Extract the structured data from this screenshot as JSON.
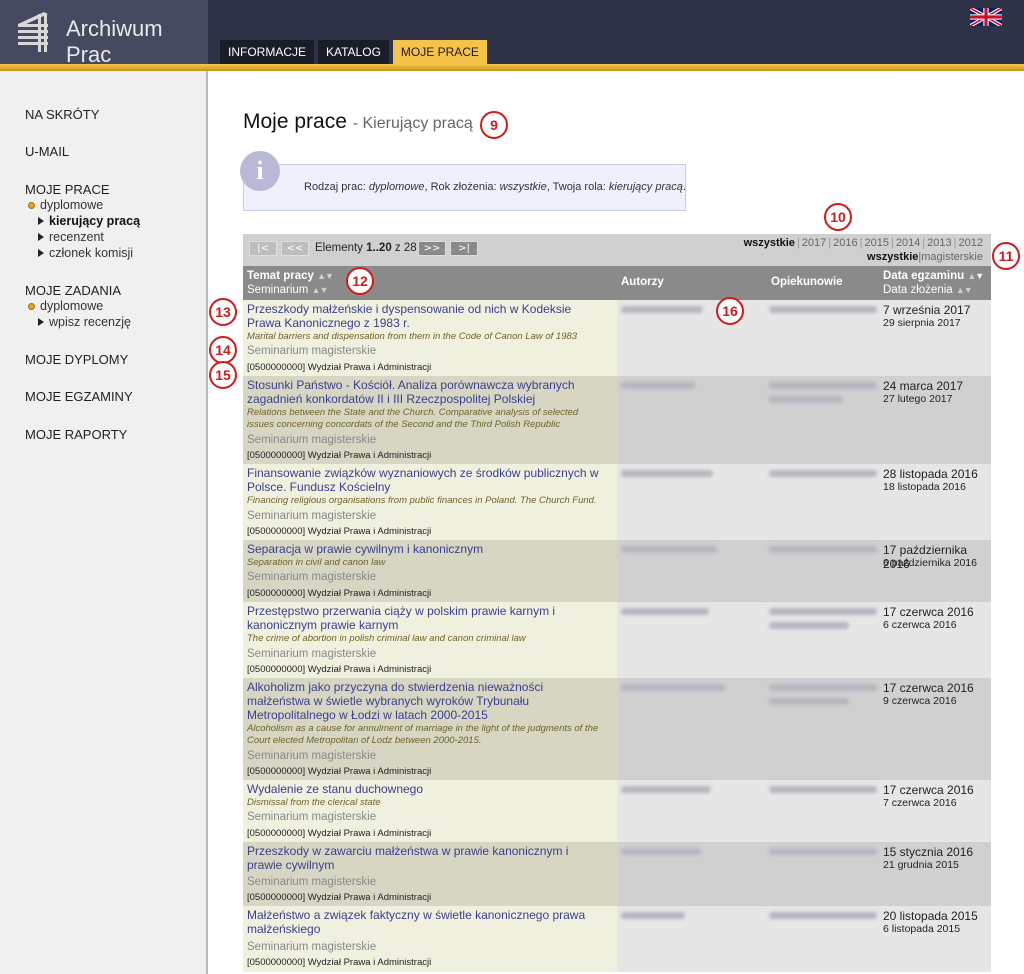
{
  "app": {
    "title": "Archiwum Prac"
  },
  "tabs": [
    {
      "label": "INFORMACJE",
      "active": false
    },
    {
      "label": "KATALOG",
      "active": false
    },
    {
      "label": "MOJE PRACE",
      "active": true
    }
  ],
  "language_flag": "uk-flag-icon",
  "sidebar": {
    "na_skroty": "NA SKRÓTY",
    "umail": "U-MAIL",
    "moje_prace": "MOJE PRACE",
    "dyplomowe": "dyplomowe",
    "kierujacy": "kierujący pracą",
    "recenzent": "recenzent",
    "czlonek": "członek komisji",
    "moje_zadania": "MOJE ZADANIA",
    "zad_dyplomowe": "dyplomowe",
    "wpisz": "wpisz recenzję",
    "moje_dyplomy": "MOJE DYPLOMY",
    "moje_egzaminy": "MOJE EGZAMINY",
    "moje_raporty": "MOJE RAPORTY"
  },
  "page": {
    "title": "Moje prace",
    "subtitle": "- Kierujący pracą"
  },
  "info": {
    "prefix1": "Rodzaj prac: ",
    "rodzaj": "dyplomowe",
    "prefix2": ", Rok złożenia: ",
    "rok": "wszystkie",
    "prefix3": ", Twoja rola: ",
    "rola": "kierujący pracą",
    "suffix": "."
  },
  "pagination": {
    "first": "|<",
    "prev": "<<",
    "next": ">>",
    "last": ">|",
    "label": "Elementy",
    "range": "1..20",
    "of": "z",
    "total": "28"
  },
  "year_filter": {
    "active": "wszystkie",
    "years": [
      "2017",
      "2016",
      "2015",
      "2014",
      "2013",
      "2012"
    ]
  },
  "type_filter": {
    "active": "wszystkie",
    "other": "magisterskie"
  },
  "columns": {
    "topic": "Temat pracy",
    "seminar": "Seminarium",
    "authors": "Autorzy",
    "supervisors": "Opiekunowie",
    "exam_date": "Data egzaminu",
    "submit_date": "Data złożenia"
  },
  "rows": [
    {
      "title": "Przeszkody małżeńskie i dyspensowanie od nich w Kodeksie Prawa Kanonicznego z 1983 r.",
      "title_en": "Marital barriers and dispensation from them in the Code of Canon Law of 1983",
      "seminar": "Seminarium magisterskie",
      "faculty": "[0500000000] Wydział Prawa i Administracji",
      "exam": "7 września 2017",
      "submitted": "29 sierpnia 2017"
    },
    {
      "title": "Stosunki Państwo - Kościół. Analiza porównawcza wybranych zagadnień konkordatów II i III Rzeczpospolitej Polskiej",
      "title_en": "Relations between the State and the Church. Comparative analysis of selected issues concerning concordats of the Second and the Third Polish Republic",
      "seminar": "Seminarium magisterskie",
      "faculty": "[0500000000] Wydział Prawa i Administracji",
      "exam": "24 marca 2017",
      "submitted": "27 lutego 2017"
    },
    {
      "title": "Finansowanie związków wyznaniowych ze środków publicznych w Polsce. Fundusz Kościelny",
      "title_en": "Financing religious organisations from public finances in Poland. The Church Fund.",
      "seminar": "Seminarium magisterskie",
      "faculty": "[0500000000] Wydział Prawa i Administracji",
      "exam": "28 listopada 2016",
      "submitted": "18 listopada 2016"
    },
    {
      "title": "Separacja w prawie cywilnym i kanonicznym",
      "title_en": "Separation in civil and canon law",
      "seminar": "Seminarium magisterskie",
      "faculty": "[0500000000] Wydział Prawa i Administracji",
      "exam": "17 października 2016",
      "submitted": "6 października 2016"
    },
    {
      "title": "Przestępstwo przerwania ciąży w polskim prawie karnym i kanonicznym prawie karnym",
      "title_en": "The crime of abortion in polish criminal law and canon criminal law",
      "seminar": "Seminarium magisterskie",
      "faculty": "[0500000000] Wydział Prawa i Administracji",
      "exam": "17 czerwca 2016",
      "submitted": "6 czerwca 2016"
    },
    {
      "title": "Alkoholizm jako przyczyna do stwierdzenia nieważności małżeństwa w świetle wybranych wyroków Trybunału Metropolitalnego w Łodzi w latach 2000-2015",
      "title_en": "Alcoholism as a cause for annulment of marriage in the light of the judgments of the Court elected Metropolitan of Lodz between 2000-2015.",
      "seminar": "Seminarium magisterskie",
      "faculty": "[0500000000] Wydział Prawa i Administracji",
      "exam": "17 czerwca 2016",
      "submitted": "9 czerwca 2016"
    },
    {
      "title": "Wydalenie ze stanu duchownego",
      "title_en": "Dismissal from the clerical state",
      "seminar": "Seminarium magisterskie",
      "faculty": "[0500000000] Wydział Prawa i Administracji",
      "exam": "17 czerwca 2016",
      "submitted": "7 czerwca 2016"
    },
    {
      "title": "Przeszkody w zawarciu małżeństwa w prawie kanonicznym i prawie cywilnym",
      "title_en": "",
      "seminar": "Seminarium magisterskie",
      "faculty": "[0500000000] Wydział Prawa i Administracji",
      "exam": "15 stycznia 2016",
      "submitted": "21 grudnia 2015"
    },
    {
      "title": "Małżeństwo a związek faktyczny w świetle kanonicznego prawa małżeńskiego",
      "title_en": "",
      "seminar": "Seminarium magisterskie",
      "faculty": "[0500000000] Wydział Prawa i Administracji",
      "exam": "20 listopada 2015",
      "submitted": "6 listopada 2015"
    }
  ],
  "markers": [
    "9",
    "10",
    "11",
    "12",
    "13",
    "14",
    "15",
    "16"
  ]
}
